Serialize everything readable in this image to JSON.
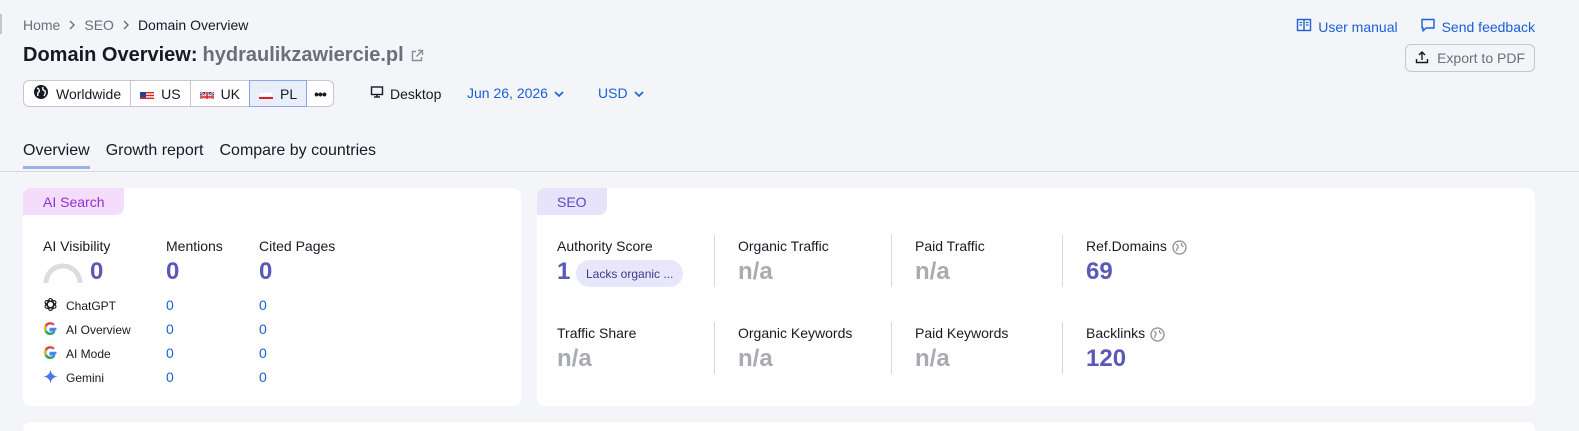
{
  "breadcrumb": [
    "Home",
    "SEO",
    "Domain Overview"
  ],
  "header": {
    "title": "Domain Overview:",
    "domain": "hydraulikzawiercie.pl",
    "user_manual": "User manual",
    "send_feedback": "Send feedback",
    "export": "Export to PDF"
  },
  "filters": {
    "databases": [
      {
        "label": "Worldwide",
        "icon": "globe-icon"
      },
      {
        "label": "US",
        "icon": "us-flag-icon"
      },
      {
        "label": "UK",
        "icon": "uk-flag-icon"
      },
      {
        "label": "PL",
        "icon": "pl-flag-icon",
        "selected": true
      }
    ],
    "more": "•••",
    "device": "Desktop",
    "date": "Jun 26, 2026",
    "currency": "USD"
  },
  "tabs": [
    "Overview",
    "Growth report",
    "Compare by countries"
  ],
  "ai_search": {
    "badge": "AI Search",
    "visibility_label": "AI Visibility",
    "visibility_value": "0",
    "mentions_label": "Mentions",
    "mentions_value": "0",
    "cited_label": "Cited Pages",
    "cited_value": "0",
    "sources": [
      {
        "name": "ChatGPT",
        "icon": "chatgpt-icon",
        "mentions": "0",
        "cited": "0"
      },
      {
        "name": "AI Overview",
        "icon": "google-icon",
        "mentions": "0",
        "cited": "0"
      },
      {
        "name": "AI Mode",
        "icon": "google-icon",
        "mentions": "0",
        "cited": "0"
      },
      {
        "name": "Gemini",
        "icon": "gemini-icon",
        "mentions": "0",
        "cited": "0"
      }
    ]
  },
  "seo": {
    "badge": "SEO",
    "authority_label": "Authority Score",
    "authority_value": "1",
    "authority_pill": "Lacks organic ...",
    "organic_traffic_label": "Organic Traffic",
    "organic_traffic_value": "n/a",
    "paid_traffic_label": "Paid Traffic",
    "paid_traffic_value": "n/a",
    "ref_domains_label": "Ref.Domains",
    "ref_domains_value": "69",
    "traffic_share_label": "Traffic Share",
    "traffic_share_value": "n/a",
    "organic_keywords_label": "Organic Keywords",
    "organic_keywords_value": "n/a",
    "paid_keywords_label": "Paid Keywords",
    "paid_keywords_value": "n/a",
    "backlinks_label": "Backlinks",
    "backlinks_value": "120"
  },
  "colors": {
    "accent_blue": "#1a5fd6",
    "value_purple": "#5b58b8",
    "ai_badge": "#f4ddfb",
    "seo_badge": "#e7e3fb"
  }
}
